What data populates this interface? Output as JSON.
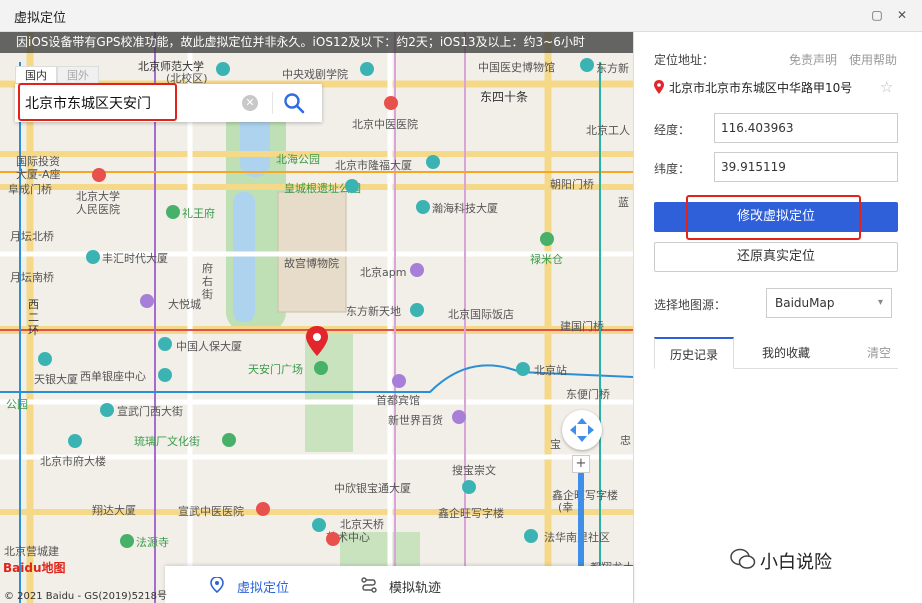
{
  "window": {
    "title": "虚拟定位",
    "restore": "▢",
    "close": "✕"
  },
  "map": {
    "notice": "因iOS设备带有GPS校准功能，故此虚拟定位并非永久。iOS12及以下：约2天；iOS13及以上：约3~6小时",
    "tab_domestic": "国内",
    "tab_foreign": "国外",
    "search_value": "北京市东城区天安门",
    "clear_glyph": "✕",
    "labels": [
      {
        "t": "北京师范大学",
        "c": "dark"
      },
      {
        "t": "(北校区)",
        "c": ""
      },
      {
        "t": "中央戏剧学院",
        "c": ""
      },
      {
        "t": "中国医史博物馆",
        "c": ""
      },
      {
        "t": "东四十条",
        "c": "bigroad"
      },
      {
        "t": "北京中医医院",
        "c": ""
      },
      {
        "t": "北海公园",
        "c": "green"
      },
      {
        "t": "北京市隆福大厦",
        "c": ""
      },
      {
        "t": "国际投资",
        "c": ""
      },
      {
        "t": "大厦-A座",
        "c": ""
      },
      {
        "t": "阜成门桥",
        "c": ""
      },
      {
        "t": "北京大学",
        "c": ""
      },
      {
        "t": "人民医院",
        "c": ""
      },
      {
        "t": "皇城根遗址公园",
        "c": "green"
      },
      {
        "t": "朝阳门桥",
        "c": ""
      },
      {
        "t": "礼王府",
        "c": "green"
      },
      {
        "t": "瀚海科技大厦",
        "c": ""
      },
      {
        "t": "月坛北桥",
        "c": ""
      },
      {
        "t": "丰汇时代大厦",
        "c": ""
      },
      {
        "t": "故宫博物院",
        "c": ""
      },
      {
        "t": "禄米仓",
        "c": "green"
      },
      {
        "t": "北京apm",
        "c": ""
      },
      {
        "t": "府",
        "c": ""
      },
      {
        "t": "右",
        "c": ""
      },
      {
        "t": "街",
        "c": ""
      },
      {
        "t": "月坛南桥",
        "c": ""
      },
      {
        "t": "大悦城",
        "c": ""
      },
      {
        "t": "东方新天地",
        "c": ""
      },
      {
        "t": "北京国际饭店",
        "c": ""
      },
      {
        "t": "建国门桥",
        "c": ""
      },
      {
        "t": "西",
        "c": ""
      },
      {
        "t": "二",
        "c": ""
      },
      {
        "t": "环",
        "c": ""
      },
      {
        "t": "中国人保大厦",
        "c": ""
      },
      {
        "t": "北京站",
        "c": ""
      },
      {
        "t": "天银大厦",
        "c": ""
      },
      {
        "t": "西单银座中心",
        "c": ""
      },
      {
        "t": "天安门广场",
        "c": "green"
      },
      {
        "t": "首都宾馆",
        "c": ""
      },
      {
        "t": "东便门桥",
        "c": ""
      },
      {
        "t": "公园",
        "c": "green"
      },
      {
        "t": "宣武门西大街",
        "c": ""
      },
      {
        "t": "新世界百货",
        "c": ""
      },
      {
        "t": "琉璃厂文化街",
        "c": "green"
      },
      {
        "t": "北京市府大楼",
        "c": ""
      },
      {
        "t": "搜宝崇文",
        "c": ""
      },
      {
        "t": "中欣银宝通大厦",
        "c": ""
      },
      {
        "t": "鑫企旺写字楼",
        "c": ""
      },
      {
        "t": "(幸",
        "c": ""
      },
      {
        "t": "翔达大厦",
        "c": ""
      },
      {
        "t": "宣武中医医院",
        "c": ""
      },
      {
        "t": "北京天桥",
        "c": ""
      },
      {
        "t": "鑫企旺写字楼",
        "c": ""
      },
      {
        "t": "艺术中心",
        "c": ""
      },
      {
        "t": "法源寺",
        "c": "green"
      },
      {
        "t": "法华南里社区",
        "c": ""
      },
      {
        "t": "北京营城建",
        "c": ""
      },
      {
        "t": "都翔龙大厦",
        "c": ""
      },
      {
        "t": "北京工人",
        "c": ""
      },
      {
        "t": "东方新",
        "c": ""
      },
      {
        "t": "忠",
        "c": ""
      },
      {
        "t": "宝",
        "c": ""
      },
      {
        "t": "蓝",
        "c": ""
      }
    ],
    "baidu_logo": "Baidu地图",
    "copyright": "© 2021 Baidu - GS(2019)5218号",
    "zoom_in": "+",
    "zoom_out": "−",
    "bottom_tab_virtual": "虚拟定位",
    "bottom_tab_track": "模拟轨迹"
  },
  "panel": {
    "location_label": "定位地址：",
    "disclaimer": "免责声明",
    "help": "使用帮助",
    "address": "北京市北京市东城区中华路甲10号",
    "longitude_label": "经度：",
    "longitude": "116.403963",
    "latitude_label": "纬度：",
    "latitude": "39.915119",
    "modify_button": "修改虚拟定位",
    "restore_button": "还原真实定位",
    "map_source_label": "选择地图源：",
    "map_source": "BaiduMap",
    "tab_history": "历史记录",
    "tab_favorites": "我的收藏",
    "clear": "清空"
  },
  "watermark": "小白说险"
}
